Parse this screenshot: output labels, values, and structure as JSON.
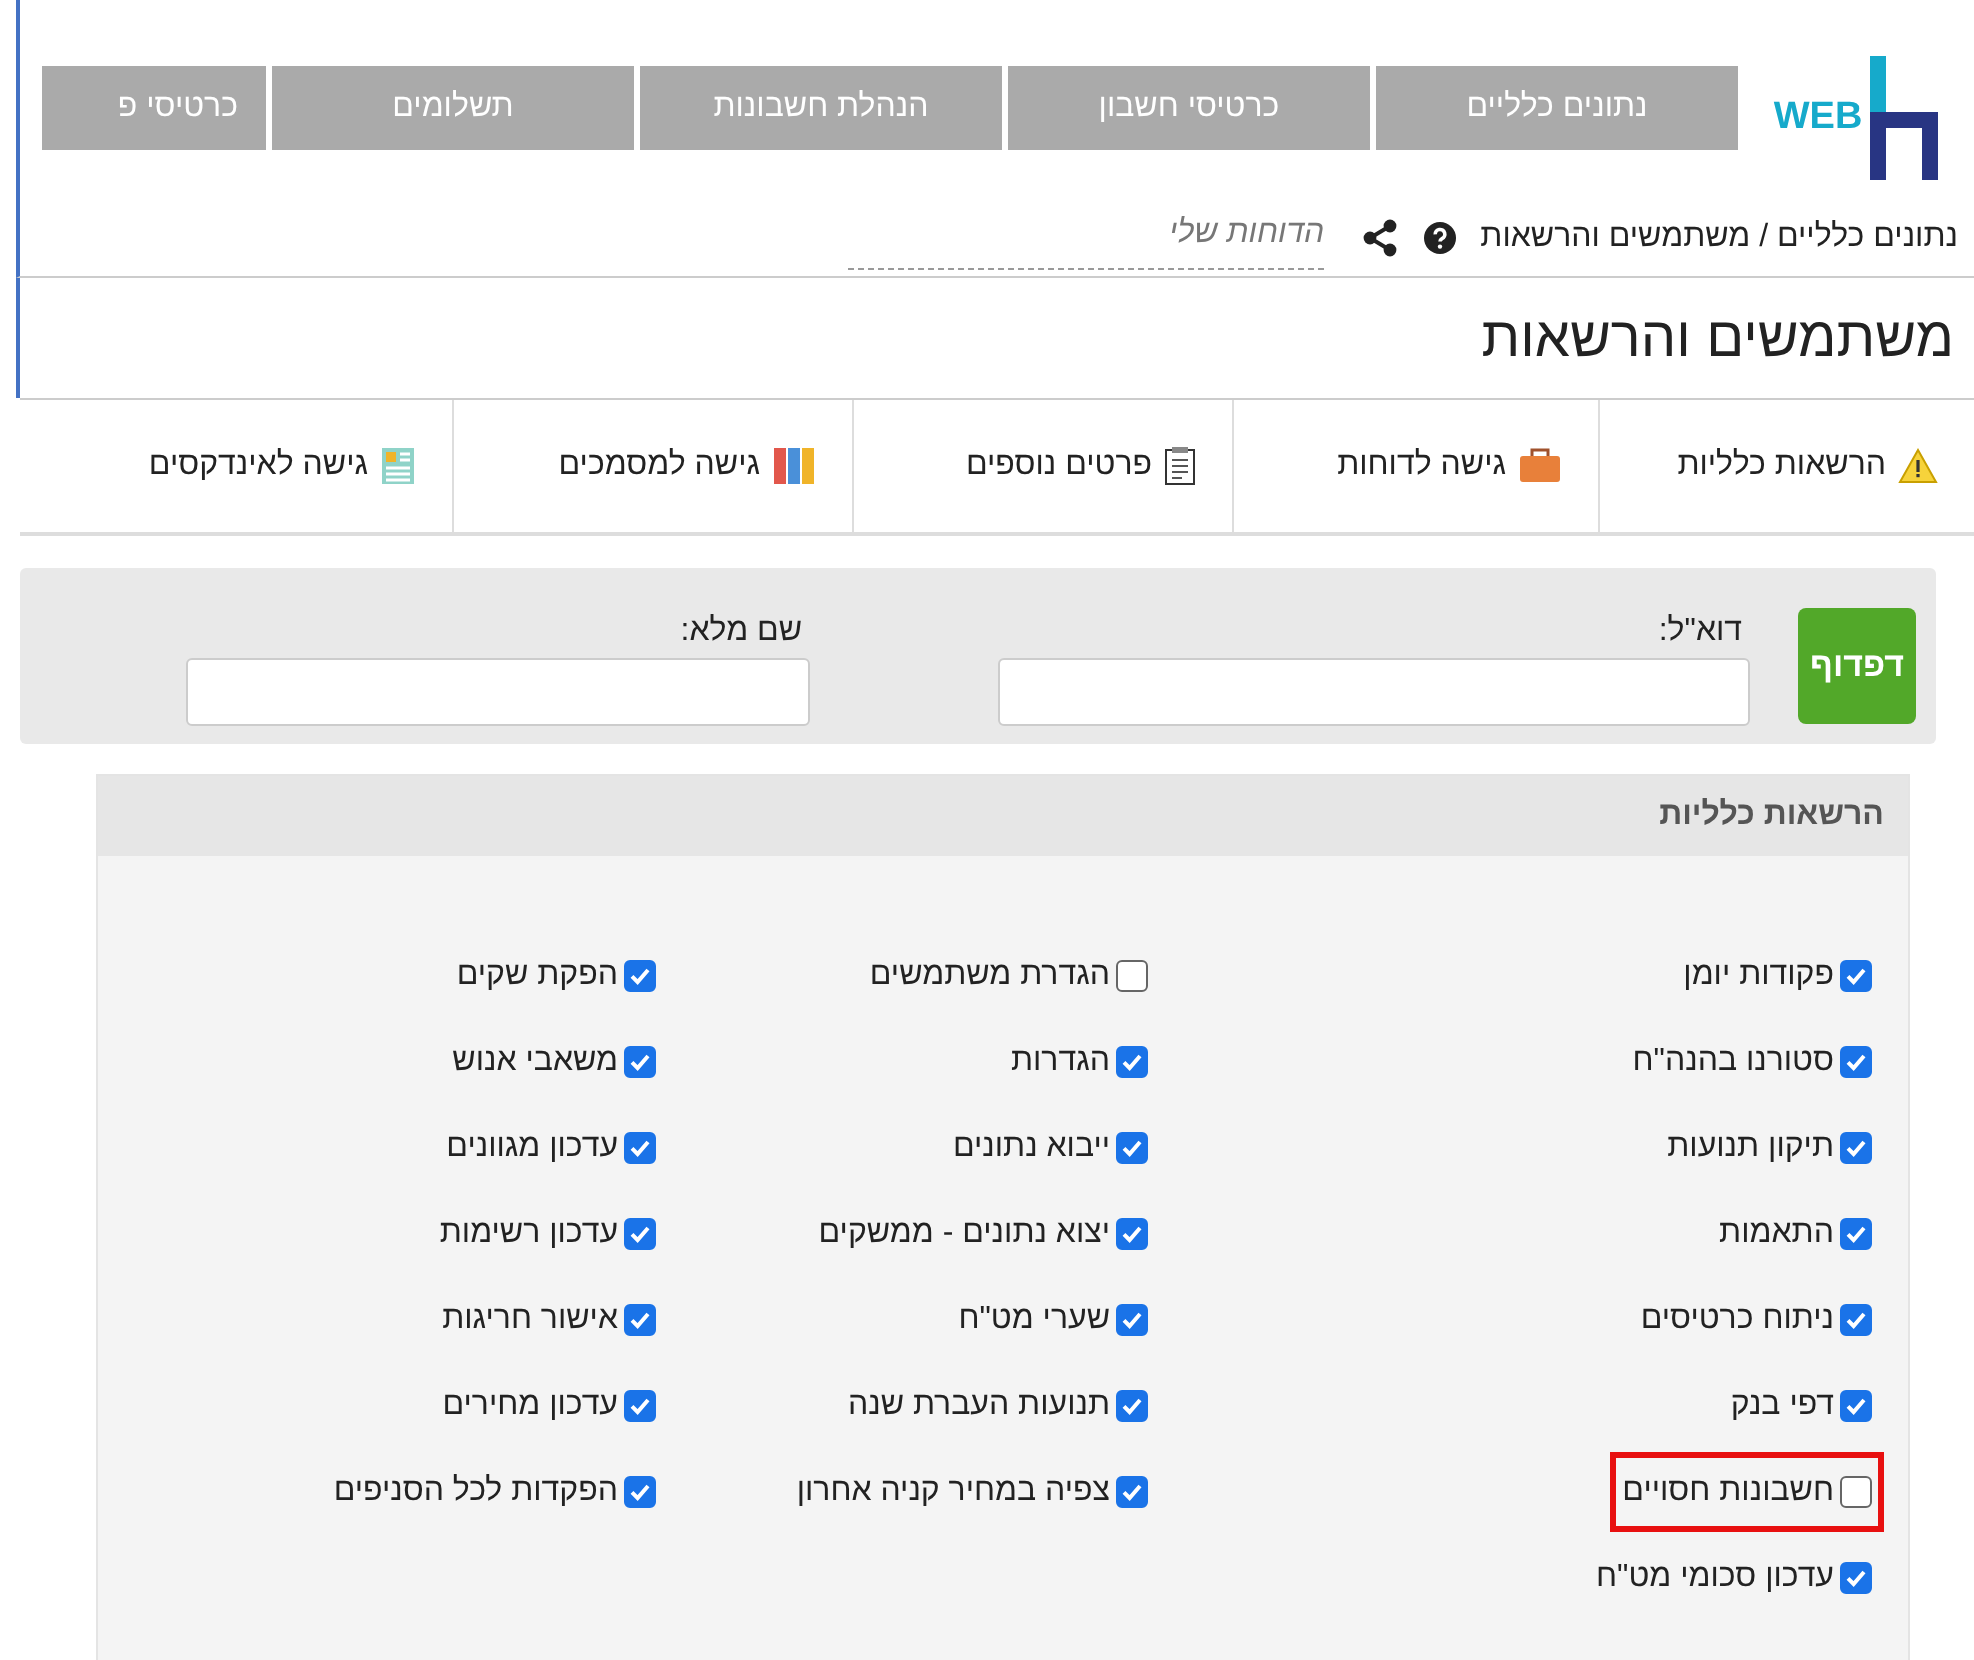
{
  "logo": {
    "text": "WEB"
  },
  "nav": [
    {
      "label": "נתונים כלליים"
    },
    {
      "label": "כרטיסי חשבון"
    },
    {
      "label": "הנהלת חשבונות"
    },
    {
      "label": "תשלומים"
    },
    {
      "label": "כרטיסי פ"
    }
  ],
  "breadcrumb": {
    "path": "נתונים כלליים / משתמשים והרשאות",
    "my_reports": "הדוחות שלי"
  },
  "title": "משתמשים והרשאות",
  "tabs": [
    {
      "label": "הרשאות כלליות",
      "kind": "warning"
    },
    {
      "label": "גישה לדוחות",
      "kind": "briefcase"
    },
    {
      "label": "פרטים נוספים",
      "kind": "clipboard"
    },
    {
      "label": "גישה למסמכים",
      "kind": "binders"
    },
    {
      "label": "גישה לאינדקסים",
      "kind": "index"
    }
  ],
  "filter": {
    "button": "דפדוף",
    "email_label": "דוא\"ל:",
    "name_label": "שם מלא:"
  },
  "permissions": {
    "title": "הרשאות כלליות",
    "columns": [
      [
        {
          "label": "פקודות יומן",
          "checked": true,
          "highlighted": false
        },
        {
          "label": "סטורנו בהנה\"ח",
          "checked": true,
          "highlighted": false
        },
        {
          "label": "תיקון תנועות",
          "checked": true,
          "highlighted": false
        },
        {
          "label": "התאמות",
          "checked": true,
          "highlighted": false
        },
        {
          "label": "ניתוח כרטיסים",
          "checked": true,
          "highlighted": false
        },
        {
          "label": "דפי בנק",
          "checked": true,
          "highlighted": false
        },
        {
          "label": "חשבונות חסויים",
          "checked": false,
          "highlighted": true
        },
        {
          "label": "עדכון סכומי מט\"ח",
          "checked": true,
          "highlighted": false
        }
      ],
      [
        {
          "label": "הגדרת משתמשים",
          "checked": false,
          "highlighted": false
        },
        {
          "label": "הגדרות",
          "checked": true,
          "highlighted": false
        },
        {
          "label": "ייבוא נתונים",
          "checked": true,
          "highlighted": false
        },
        {
          "label": "יצוא נתונים - ממשקים",
          "checked": true,
          "highlighted": false
        },
        {
          "label": "שערי מט\"ח",
          "checked": true,
          "highlighted": false
        },
        {
          "label": "תנועות העברת שנה",
          "checked": true,
          "highlighted": false
        },
        {
          "label": "צפיה במחיר קניה אחרון",
          "checked": true,
          "highlighted": false
        }
      ],
      [
        {
          "label": "הפקת שקים",
          "checked": true,
          "highlighted": false
        },
        {
          "label": "משאבי אנוש",
          "checked": true,
          "highlighted": false
        },
        {
          "label": "עדכון מגוונים",
          "checked": true,
          "highlighted": false
        },
        {
          "label": "עדכון רשימות",
          "checked": true,
          "highlighted": false
        },
        {
          "label": "אישור חריגות",
          "checked": true,
          "highlighted": false
        },
        {
          "label": "עדכון מחירים",
          "checked": true,
          "highlighted": false
        },
        {
          "label": "הפקדות לכל הסניפים",
          "checked": true,
          "highlighted": false
        }
      ]
    ]
  }
}
